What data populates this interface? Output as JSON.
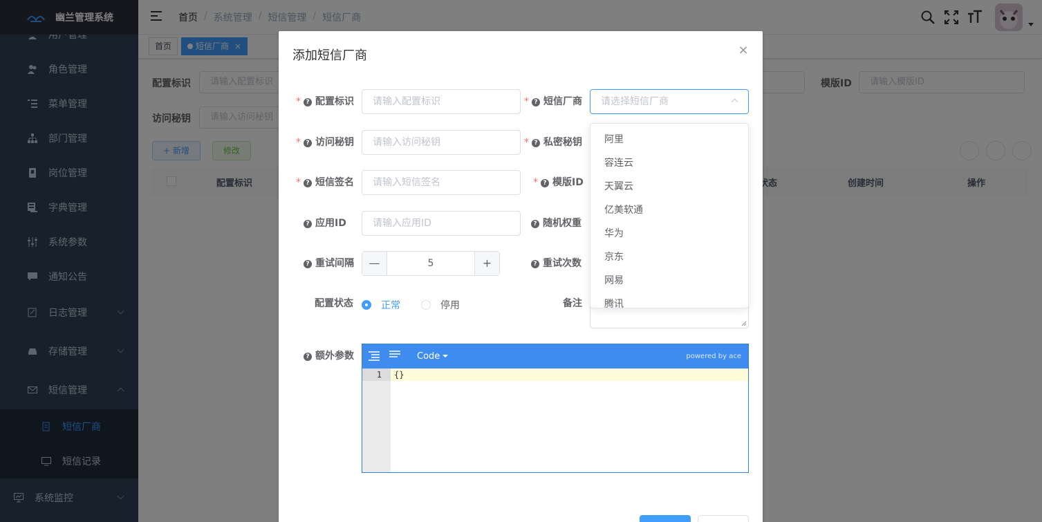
{
  "app": {
    "title": "幽兰管理系统"
  },
  "sidebar": {
    "items": [
      {
        "label": "用户管理",
        "icon": "user-icon"
      },
      {
        "label": "角色管理",
        "icon": "peoples-icon"
      },
      {
        "label": "菜单管理",
        "icon": "tree-table-icon"
      },
      {
        "label": "部门管理",
        "icon": "tree-icon"
      },
      {
        "label": "岗位管理",
        "icon": "post-icon"
      },
      {
        "label": "字典管理",
        "icon": "dict-icon"
      },
      {
        "label": "系统参数",
        "icon": "edit-icon"
      },
      {
        "label": "通知公告",
        "icon": "message-icon"
      },
      {
        "label": "日志管理",
        "icon": "log-icon"
      },
      {
        "label": "存储管理",
        "icon": "storage-icon"
      },
      {
        "label": "短信管理",
        "icon": "sms-icon"
      },
      {
        "label": "短信厂商",
        "icon": "doc-icon"
      },
      {
        "label": "短信记录",
        "icon": "record-icon"
      },
      {
        "label": "系统监控",
        "icon": "monitor-icon"
      }
    ]
  },
  "breadcrumb": [
    "首页",
    "系统管理",
    "短信管理",
    "短信厂商"
  ],
  "tags": {
    "home": "首页",
    "active": "短信厂商",
    "close": "×"
  },
  "query": {
    "config_key_label": "配置标识",
    "config_key_placeholder": "请输入配置标识",
    "access_key_label": "访问秘钥",
    "access_key_placeholder": "请输入访问秘钥",
    "template_label": "模版ID",
    "template_placeholder": "请输入模版ID"
  },
  "toolbar": {
    "add": "+ 新增",
    "edit": "修改"
  },
  "table": {
    "columns": [
      "配置标识",
      "状态",
      "创建时间",
      "操作"
    ]
  },
  "dialog": {
    "title": "添加短信厂商",
    "close": "×",
    "fields": {
      "config_key": {
        "label": "配置标识",
        "placeholder": "请输入配置标识"
      },
      "supplier": {
        "label": "短信厂商",
        "placeholder": "请选择短信厂商"
      },
      "access_key": {
        "label": "访问秘钥",
        "placeholder": "请输入访问秘钥"
      },
      "secret_key": {
        "label": "私密秘钥"
      },
      "signature": {
        "label": "短信签名",
        "placeholder": "请输入短信签名"
      },
      "template_id": {
        "label": "模版ID"
      },
      "app_id": {
        "label": "应用ID",
        "placeholder": "请输入应用ID"
      },
      "weight": {
        "label": "随机权重"
      },
      "retry_interval": {
        "label": "重试间隔",
        "value": "5",
        "minus": "—",
        "plus": "+"
      },
      "retry_count": {
        "label": "重试次数"
      },
      "status": {
        "label": "配置状态",
        "options": [
          "正常",
          "停用"
        ],
        "selected": "正常"
      },
      "remark": {
        "label": "备注"
      },
      "extra": {
        "label": "额外参数"
      }
    },
    "supplier_options": [
      "阿里",
      "容连云",
      "天翼云",
      "亿美软通",
      "华为",
      "京东",
      "网易",
      "腾讯"
    ],
    "editor": {
      "mode": "Code",
      "powered": "powered by ace",
      "line": "1",
      "content": "{}"
    }
  },
  "colors": {
    "sidebar": "#304156",
    "accent": "#409eff",
    "editor_bar": "#3f8cf1"
  }
}
